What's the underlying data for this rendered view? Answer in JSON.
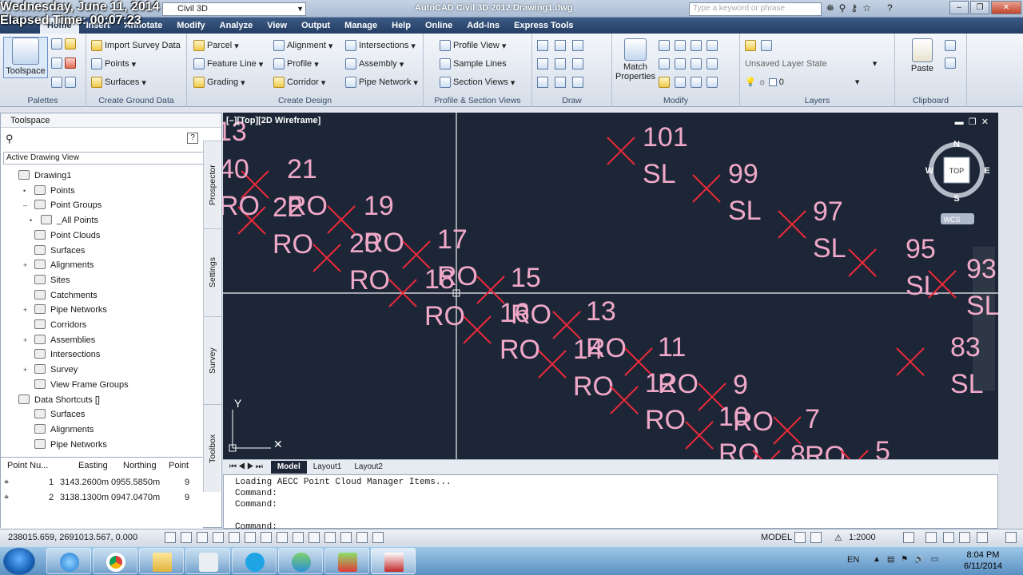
{
  "overlay": {
    "date_line": "Wednesday, June 11, 2014",
    "elapsed": "Elapsed Time: 00:07:23"
  },
  "titlebar": {
    "workspace": "Civil 3D",
    "app_title": "AutoCAD Civil 3D 2012    Drawing1.dwg",
    "search_placeholder": "Type a keyword or phrase"
  },
  "menu": {
    "tabs": [
      "Home",
      "Insert",
      "Annotate",
      "Modify",
      "Analyze",
      "View",
      "Output",
      "Manage",
      "Help",
      "Online",
      "Add-Ins",
      "Express Tools"
    ],
    "active": "Home"
  },
  "ribbon": {
    "palettes": {
      "big": "Toolspace",
      "title": "Palettes"
    },
    "ground": {
      "items": [
        "Import Survey Data",
        "Points",
        "Surfaces"
      ],
      "title": "Create Ground Data"
    },
    "design": {
      "items": [
        "Parcel",
        "Feature Line",
        "Grading",
        "Alignment",
        "Profile",
        "Corridor",
        "Intersections",
        "Assembly",
        "Pipe Network"
      ],
      "title": "Create Design"
    },
    "profile": {
      "items": [
        "Profile View",
        "Sample Lines",
        "Section Views"
      ],
      "title": "Profile & Section Views"
    },
    "draw": {
      "title": "Draw"
    },
    "modify": {
      "big": "Match Properties",
      "title": "Modify"
    },
    "layers": {
      "layer_state": "Unsaved Layer State",
      "current": "0",
      "title": "Layers"
    },
    "clipboard": {
      "big": "Paste",
      "title": "Clipboard"
    }
  },
  "toolspace": {
    "title": "Toolspace",
    "view": "Active Drawing View",
    "tree": [
      "Drawing1",
      "Points",
      "Point Groups",
      "_All Points",
      "Point Clouds",
      "Surfaces",
      "Alignments",
      "Sites",
      "Catchments",
      "Pipe Networks",
      "Corridors",
      "Assemblies",
      "Intersections",
      "Survey",
      "View Frame Groups",
      "Data Shortcuts []",
      "Surfaces",
      "Alignments",
      "Pipe Networks"
    ],
    "vtabs": [
      "Prospector",
      "Settings",
      "Survey",
      "Toolbox"
    ],
    "table": {
      "headers": [
        "Point Nu...",
        "Easting",
        "Northing",
        "Point"
      ],
      "rows": [
        [
          "1",
          "3143.2600m",
          "0955.5850m",
          "9"
        ],
        [
          "2",
          "3138.1300m",
          "0947.0470m",
          "9"
        ]
      ]
    }
  },
  "viewport": {
    "label": "[–][Top][2D Wireframe]",
    "compass": {
      "n": "N",
      "s": "S",
      "e": "E",
      "w": "W",
      "top": "TOP",
      "wcs": "WCS"
    },
    "ucs": {
      "y": "Y"
    },
    "points": [
      {
        "num": "101",
        "code": "SL"
      },
      {
        "num": "99",
        "code": "SL"
      },
      {
        "num": "97",
        "code": "SL"
      },
      {
        "num": "95",
        "code": "SL"
      },
      {
        "num": "93",
        "code": "SL"
      },
      {
        "num": "83",
        "code": "SL"
      },
      {
        "num": "21",
        "code": "RO"
      },
      {
        "num": "19",
        "code": "RO"
      },
      {
        "num": "17",
        "code": "RO"
      },
      {
        "num": "15",
        "code": "RO"
      },
      {
        "num": "13",
        "code": "RO"
      },
      {
        "num": "11",
        "code": "RO"
      },
      {
        "num": "9",
        "code": "RO"
      },
      {
        "num": "7",
        "code": "RO"
      },
      {
        "num": "5",
        "code": ""
      },
      {
        "num": "22",
        "code": "RO"
      },
      {
        "num": "20",
        "code": "RO"
      },
      {
        "num": "18",
        "code": "RO"
      },
      {
        "num": "16",
        "code": "RO"
      },
      {
        "num": "14",
        "code": "RO"
      },
      {
        "num": "12",
        "code": "RO"
      },
      {
        "num": "10",
        "code": "RO"
      },
      {
        "num": "8",
        "code": ""
      },
      {
        "num": "40",
        "code": "RO"
      },
      {
        "num": "13",
        "code": ""
      }
    ]
  },
  "layout_tabs": [
    "Model",
    "Layout1",
    "Layout2"
  ],
  "command": {
    "lines": [
      "Loading AECC Point Cloud Manager Items...",
      "Command:",
      "Command:",
      "",
      "Command:"
    ]
  },
  "status": {
    "coords": "238015.659, 2691013.567, 0.000",
    "model": "MODEL",
    "scale": "1:2000"
  },
  "taskbar": {
    "lang": "EN",
    "time": "8:04 PM",
    "date": "6/11/2014"
  }
}
